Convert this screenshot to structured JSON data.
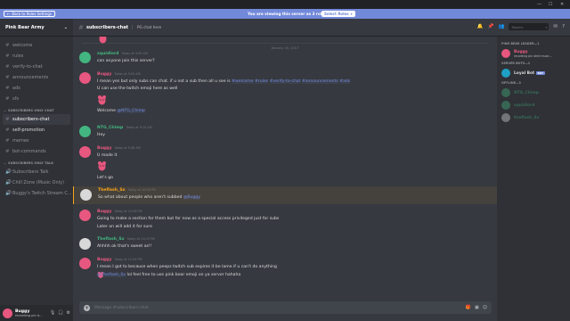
{
  "window": {
    "controls": [
      "—",
      "☐",
      "✕"
    ]
  },
  "banner": {
    "back_label": "Back to Roles Settings",
    "text": "You are viewing this server as 3 roles.",
    "select_roles_label": "Select Roles"
  },
  "server": {
    "name": "Pink Bear Army",
    "channels": [
      {
        "label": "welcome"
      },
      {
        "label": "rules"
      },
      {
        "label": "verify-to-chat"
      },
      {
        "label": "announcements"
      },
      {
        "label": "ads"
      },
      {
        "label": "sfs"
      }
    ],
    "category_sub_chat": "SUBSCRIBERS ONLY CHAT",
    "sub_channels": [
      {
        "label": "subscribers-chat"
      },
      {
        "label": "self-promotion"
      },
      {
        "label": "memes"
      },
      {
        "label": "bot-commands"
      }
    ],
    "category_sub_talk": "SUBSCRIBERS ONLY TALK",
    "voice_channels": [
      {
        "label": "Subscribers Talk"
      },
      {
        "label": "Chill Zone (Music Only)"
      },
      {
        "label": "Buggy's Twitch Stream C..."
      }
    ]
  },
  "user_panel": {
    "name": "Buggy",
    "status": "recording pin d..."
  },
  "chat_header": {
    "channel": "subscribers-chat",
    "topic": "PG chat here",
    "search_placeholder": "Search"
  },
  "date_divider": "January 18, 2017",
  "messages": [
    {
      "author": "squidlord",
      "color": "#43b581",
      "time": "Today at 9:09 AM",
      "text": "can anyone join this server?"
    },
    {
      "author": "Buggy",
      "color": "#e7577f",
      "time": "Today at 9:09 AM",
      "text_prefix": "I mean yes but only subs can chat. if u not a sub then all u see is ",
      "mentions": [
        "#welcome",
        "#rules",
        "#verify-to-chat",
        "#announcements",
        "#ads"
      ],
      "text2": "U can use the twitch emoji here as well",
      "text3_prefix": "Welcome ",
      "text3_mention": "@NTG_Chimp"
    },
    {
      "author": "NTG_Chimp",
      "color": "#43b581",
      "time": "Today at 9:10 AM",
      "text": "Hey"
    },
    {
      "author": "Buggy",
      "color": "#e7577f",
      "time": "Today at 9:38 AM",
      "text": "U made it",
      "text2": "Let's go"
    },
    {
      "author": "Theflash_Sx",
      "color": "#faa61a",
      "time": "Today at 10:58 PM",
      "text_prefix": "So what about people who aren't subbed ",
      "text_mention": "@Buggy"
    },
    {
      "author": "Buggy",
      "color": "#e7577f",
      "time": "Today at 10:58 PM",
      "text": "Going to make a section for them but for now as a special access privileged just for subs",
      "text2": "Later on will add it for sure"
    },
    {
      "author": "Theflash_Sx",
      "color": "#43b581",
      "time": "Today at 11:03 PM",
      "text": "Ahhhh ok that's sweet as!!"
    },
    {
      "author": "Buggy",
      "color": "#e7577f",
      "time": "Today at 11:04 PM",
      "text": "I mean I got to because when peeps twitch sub expires it be lame if u can't do anything",
      "text2_mention": "@Theflash_Sx",
      "text2": " lol feel free to use pink bear emoji on ya server hahaha"
    }
  ],
  "input": {
    "placeholder": "Message #subscribers-chat"
  },
  "members": {
    "leader_cat": "PINK BEAR LEADER—1",
    "leader": {
      "name": "Buggy",
      "status": "recording pin dent music..."
    },
    "bots_cat": "SERVER BOTS—1",
    "bot": {
      "name": "Loyal Bot",
      "tag": "BOT"
    },
    "offline_cat": "OFFLINE—3",
    "offline": [
      {
        "name": "NTG_Chimp"
      },
      {
        "name": "squidlord"
      },
      {
        "name": "theflash_Sx"
      }
    ]
  }
}
